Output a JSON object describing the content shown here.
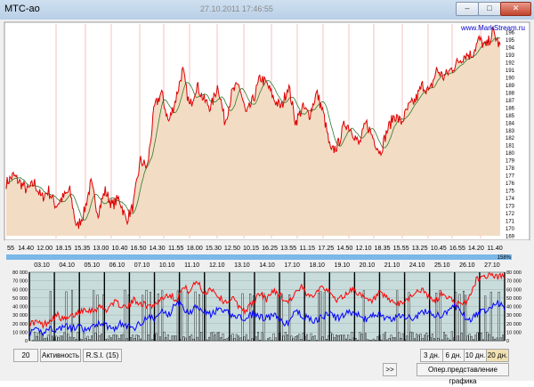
{
  "window": {
    "title": "МТС-ао",
    "center_caption": "27.10.2011 17:46:55",
    "min_icon": "minimize-icon",
    "max_icon": "maximize-icon",
    "close_icon": "close-icon"
  },
  "chart": {
    "watermark": "www.MarkStream.ru",
    "price_ticks": [
      "196",
      "195",
      "194",
      "193",
      "192",
      "191",
      "190",
      "189",
      "188",
      "187",
      "186",
      "185",
      "184",
      "183",
      "182",
      "181",
      "180",
      "179",
      "178",
      "177",
      "176",
      "175",
      "174",
      "173",
      "172",
      "171",
      "170",
      "169"
    ],
    "time_labels": [
      "55",
      "14.40",
      "12.00",
      "18.15",
      "15.35",
      "13.00",
      "10.40",
      "16.50",
      "14.30",
      "11.55",
      "18.00",
      "15.30",
      "12.50",
      "10.15",
      "16.25",
      "13.55",
      "11.15",
      "17.25",
      "14.50",
      "12.10",
      "18.35",
      "15.55",
      "13.25",
      "10.45",
      "16.55",
      "14.20",
      "11.40"
    ],
    "percent_label": "158%",
    "date_labels": [
      "03.10",
      "04.10",
      "05.10",
      "06.10",
      "07.10",
      "10.10",
      "11.10",
      "12.10",
      "13.10",
      "14.10",
      "17.10",
      "18.10",
      "19.10",
      "20.10",
      "21.10",
      "24.10",
      "25.10",
      "26.10",
      "27.10"
    ],
    "volume_ticks": [
      "80 000",
      "70 000",
      "60 000",
      "50 000",
      "40 000",
      "30 000",
      "20 000",
      "10 000",
      "0"
    ],
    "colors": {
      "price_line": "#dd0000",
      "ma_line": "#2e7a2e",
      "area_fill": "#f3dcc4",
      "rsi_red": "#ff0000",
      "rsi_blue": "#0000ff"
    },
    "chart_data": {
      "type": "line",
      "price_range": [
        169,
        196
      ],
      "price_keypoints": [
        176,
        177,
        176,
        175,
        176,
        174,
        175,
        173,
        174,
        175,
        170,
        172,
        176,
        172,
        175,
        173,
        174,
        171,
        173,
        179,
        178,
        186,
        188,
        184,
        187,
        191,
        186,
        189,
        187,
        186,
        189,
        184,
        188,
        189,
        185,
        187,
        190,
        189,
        187,
        186,
        189,
        184,
        186,
        185,
        188,
        185,
        180,
        181,
        184,
        183,
        181,
        184,
        182,
        180,
        183,
        185,
        184,
        186,
        187,
        189,
        188,
        191,
        190,
        191,
        192,
        193,
        193,
        195,
        194,
        196,
        194
      ],
      "rsi_red": [
        20,
        22,
        18,
        25,
        30,
        24,
        28,
        33,
        38,
        35,
        40,
        36,
        45,
        42,
        38,
        48,
        44,
        40,
        43,
        50,
        55,
        48,
        62,
        58,
        70,
        55,
        62,
        52,
        45,
        50,
        40,
        35,
        45,
        55,
        48,
        60,
        52,
        45,
        55,
        62,
        50,
        58,
        65,
        55,
        48,
        52,
        60,
        57,
        48,
        45,
        55,
        50,
        45,
        42,
        48,
        55,
        60,
        52,
        45,
        55,
        50,
        44,
        40,
        52,
        72,
        75,
        78,
        74,
        77
      ],
      "rsi_blue": [
        8,
        12,
        10,
        15,
        12,
        18,
        14,
        16,
        12,
        15,
        22,
        18,
        14,
        20,
        17,
        15,
        22,
        28,
        25,
        35,
        30,
        46,
        38,
        33,
        42,
        35,
        30,
        36,
        34,
        30,
        28,
        24,
        32,
        28,
        26,
        30,
        22,
        20,
        35,
        30,
        25,
        24,
        28,
        32,
        26,
        30,
        34,
        30,
        25,
        28,
        32,
        26,
        24,
        30,
        28,
        26,
        32,
        35,
        30,
        28,
        36,
        40,
        30,
        25,
        30,
        35,
        40,
        45,
        38
      ]
    }
  },
  "toolbar": {
    "period_value": "20",
    "activity_label": "Активность",
    "rsi_label": "R.S.I.",
    "rsi_period": "(15)",
    "nav_label": ">>",
    "day3_label": "3 дн.",
    "day6_label": "6 дн.",
    "day10_label": "10 дн.",
    "day20_label": "20 дн.",
    "view_label": "Опер.представление графика"
  }
}
